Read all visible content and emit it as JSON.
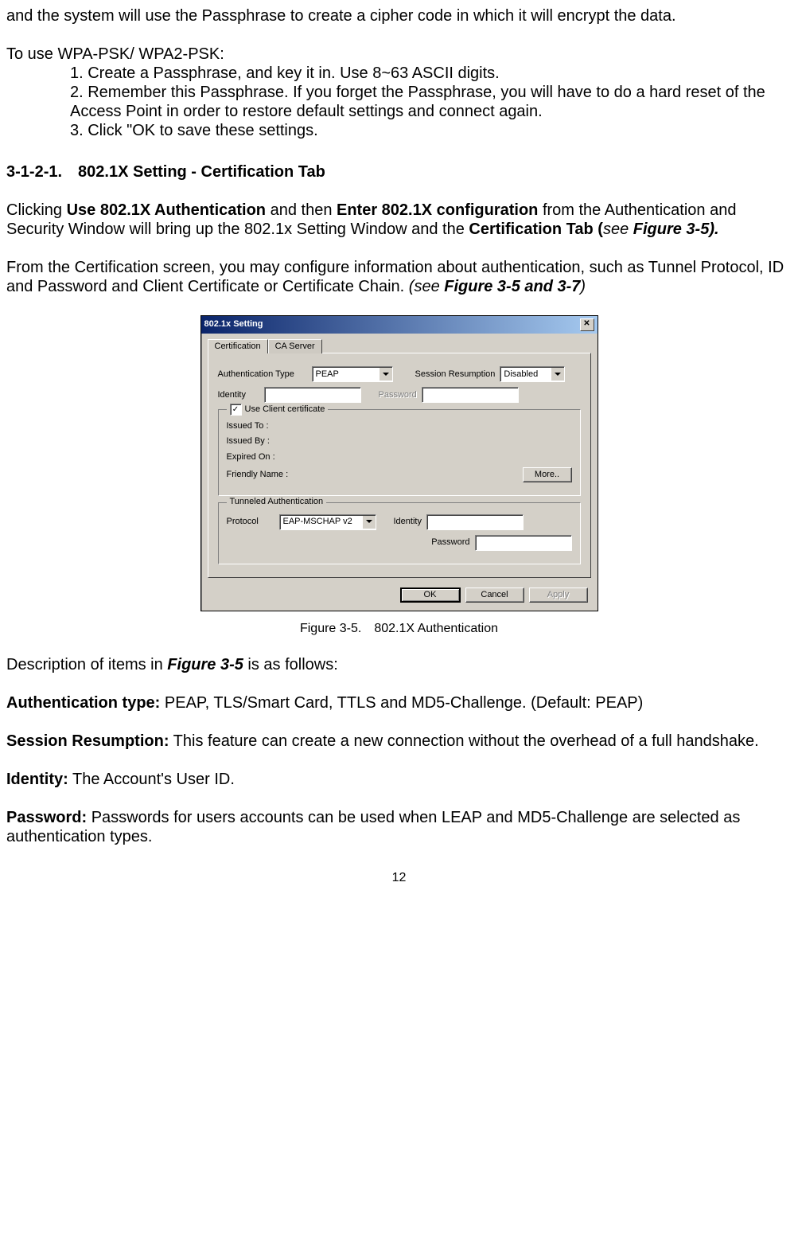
{
  "intro_text": "and the system will use the Passphrase to create a cipher code in which it will encrypt the data.",
  "wpa_heading": "To use WPA-PSK/ WPA2-PSK:",
  "wpa_steps": [
    "1. Create a Passphrase, and key it in. Use 8~63 ASCII digits.",
    "2. Remember this Passphrase. If you forget the Passphrase, you will have to do a hard reset of the Access Point in order to restore default settings and connect again.",
    "3. Click \"OK to save these settings."
  ],
  "section_heading": "3-1-2-1. 802.1X Setting - Certification Tab",
  "p1_a": "Clicking ",
  "p1_b": "Use 802.1X Authentication",
  "p1_c": " and then ",
  "p1_d": "Enter 802.1X configuration",
  "p1_e": " from the Authentication and Security Window will bring up the 802.1x Setting Window and the ",
  "p1_f": "Certification Tab (",
  "p1_g": "see ",
  "p1_h": "Figure 3-5).",
  "p2_a": "From the Certification screen, you may configure information about authentication, such as Tunnel Protocol, ID and Password and Client Certificate or Certificate Chain. ",
  "p2_b": "(see ",
  "p2_c": "Figure 3-5 and 3-7",
  "p2_d": ")",
  "dialog": {
    "title": "802.1x Setting",
    "tabs": {
      "cert": "Certification",
      "ca": "CA Server"
    },
    "labels": {
      "auth_type": "Authentication Type",
      "session": "Session Resumption",
      "identity": "Identity",
      "password": "Password",
      "use_client_cert": "Use Client certificate",
      "issued_to": "Issued To :",
      "issued_by": "Issued By :",
      "expired_on": "Expired On :",
      "friendly": "Friendly Name :",
      "more": "More..",
      "tunneled": "Tunneled Authentication",
      "protocol": "Protocol"
    },
    "values": {
      "auth_type": "PEAP",
      "session": "Disabled",
      "protocol": "EAP-MSCHAP v2"
    },
    "buttons": {
      "ok": "OK",
      "cancel": "Cancel",
      "apply": "Apply"
    },
    "close_glyph": "✕",
    "check_glyph": "✓"
  },
  "fig_caption": "Figure 3-5. 802.1X Authentication",
  "desc_intro_a": "Description of items in ",
  "desc_intro_b": "Figure 3-5",
  "desc_intro_c": " is as follows:",
  "auth_type_lbl": "Authentication type:",
  "auth_type_txt": " PEAP, TLS/Smart Card, TTLS and MD5-Challenge. (Default: PEAP)",
  "session_lbl": "Session Resumption:",
  "session_txt": " This feature can create a new connection without the overhead of a full handshake.",
  "identity_lbl": "Identity:",
  "identity_txt": " The Account's User ID.",
  "password_lbl": "Password:",
  "password_txt": " Passwords for users accounts can be used when LEAP and MD5-Challenge are selected as authentication types.",
  "page_number": "12"
}
